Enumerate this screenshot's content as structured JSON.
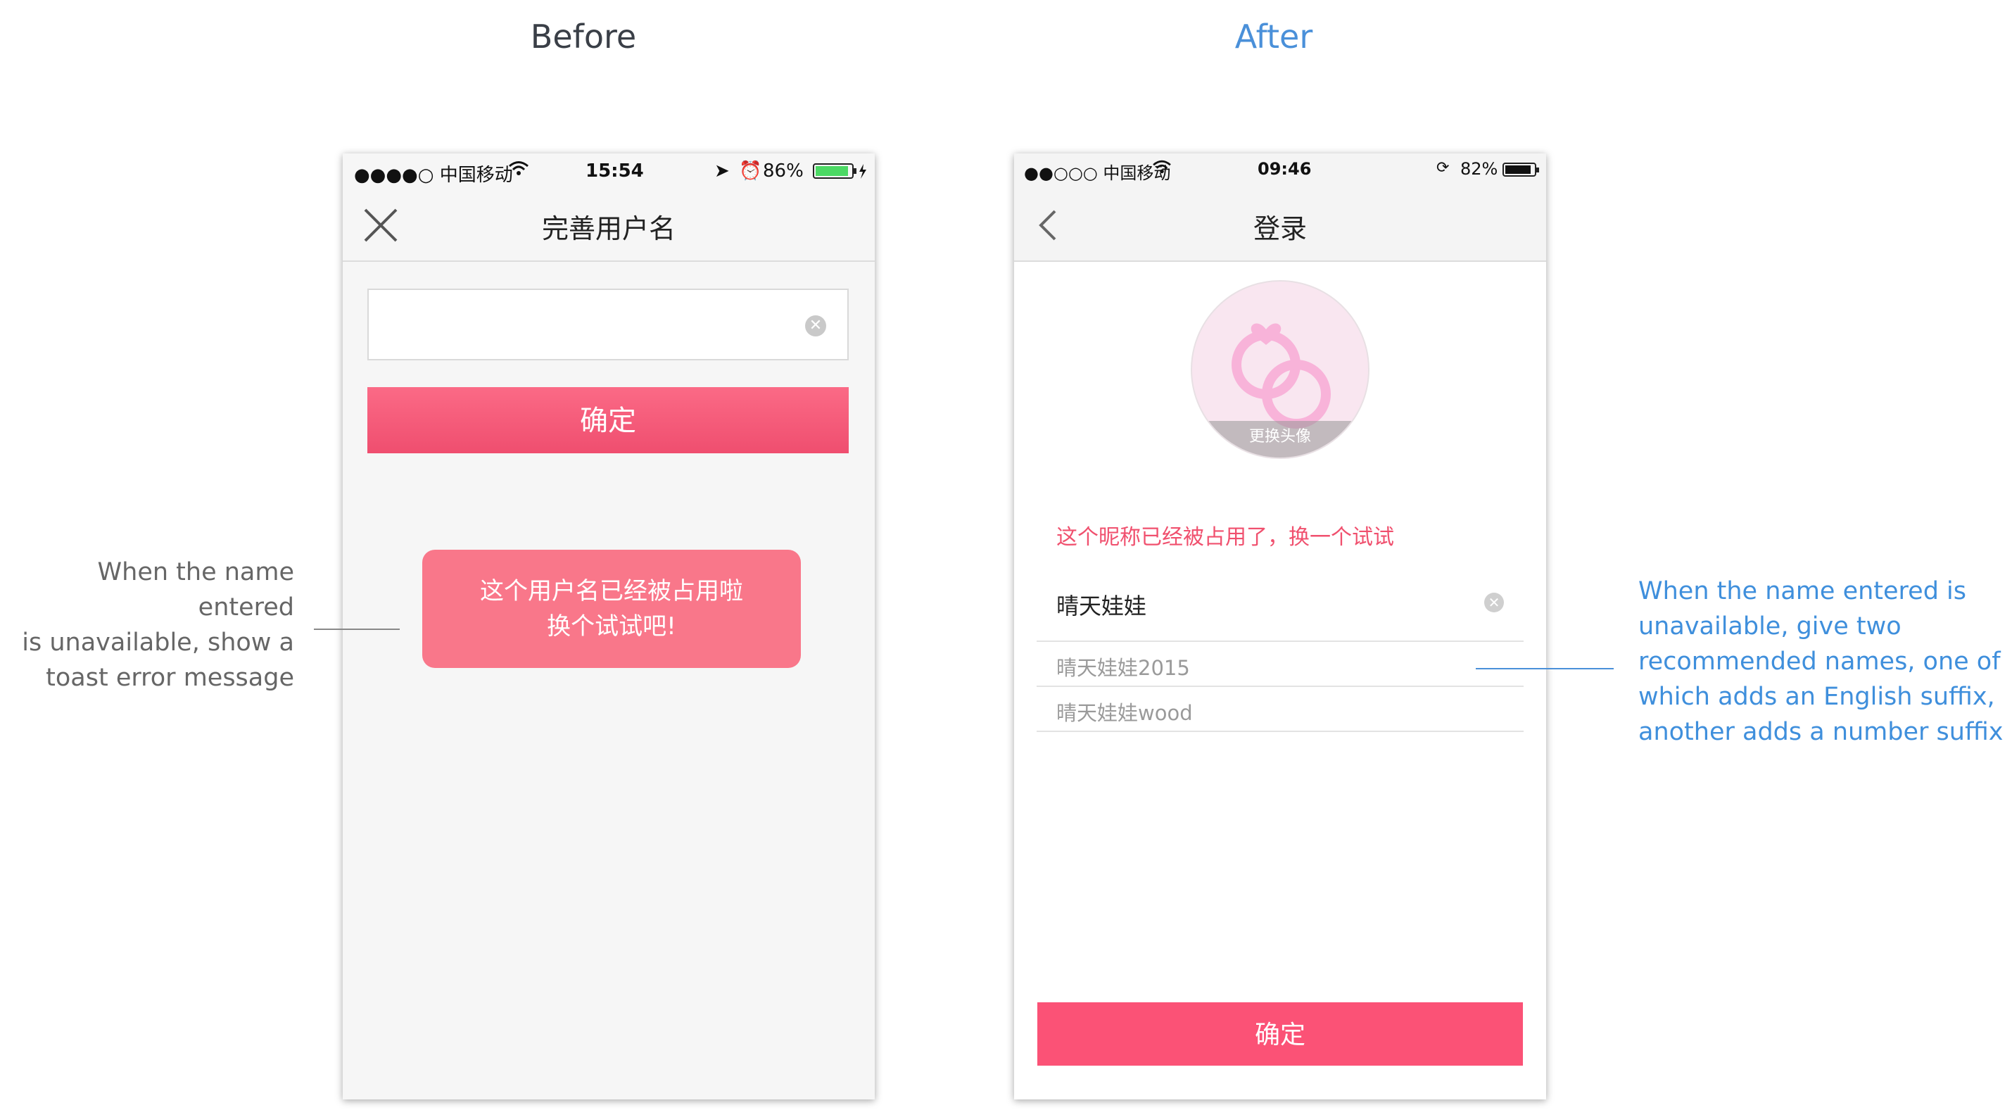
{
  "headings": {
    "before": "Before",
    "after": "After"
  },
  "before_phone": {
    "status": {
      "carrier": "●●●●○ 中国移动",
      "time": "15:54",
      "battery": "86%"
    },
    "nav": {
      "title": "完善用户名"
    },
    "confirm_label": "确定",
    "toast": {
      "line1": "这个用户名已经被占用啦",
      "line2": "换个试试吧!"
    }
  },
  "after_phone": {
    "status": {
      "carrier": "●●○○○ 中国移动",
      "time": "09:46",
      "battery": "82%"
    },
    "nav": {
      "title": "登录"
    },
    "avatar_label": "更换头像",
    "error_text": "这个昵称已经被占用了，换一个试试",
    "name_value": "晴天娃娃",
    "suggestions": [
      "晴天娃娃2015",
      "晴天娃娃wood"
    ],
    "confirm_label": "确定"
  },
  "annotations": {
    "left": [
      "When the name entered",
      "is unavailable, show a",
      "toast error message"
    ],
    "right": [
      "When the name entered is",
      "unavailable, give two",
      "recommended names, one of",
      "which adds an English suffix,",
      "another adds a number suffix"
    ]
  },
  "colors": {
    "accent_pink": "#fb5276",
    "toast_pink": "#f9778a",
    "note_blue": "#3f8fdc"
  },
  "icons": [
    "close-icon",
    "back-chevron-icon",
    "clear-input-icon",
    "wifi-icon",
    "battery-icon",
    "ring-logo-icon"
  ]
}
